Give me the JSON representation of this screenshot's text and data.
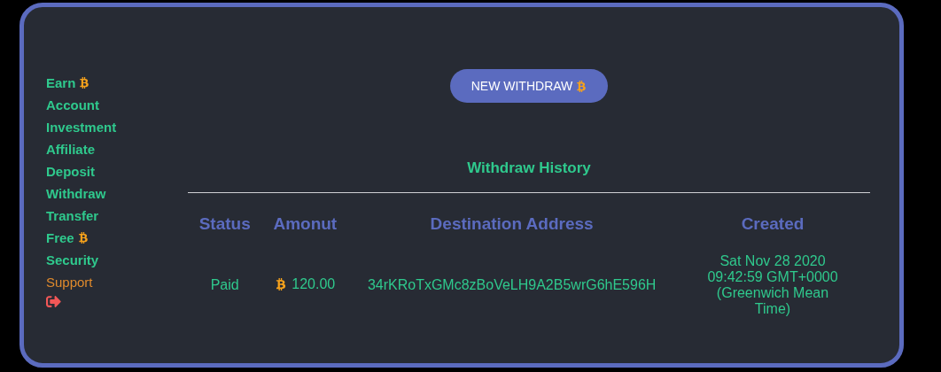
{
  "nav": [
    {
      "kind": "coin_link",
      "label": "Earn"
    },
    {
      "kind": "link",
      "label": "Account"
    },
    {
      "kind": "link",
      "label": "Investment"
    },
    {
      "kind": "link",
      "label": "Affiliate"
    },
    {
      "kind": "link",
      "label": "Deposit"
    },
    {
      "kind": "link",
      "label": "Withdraw"
    },
    {
      "kind": "link",
      "label": "Transfer"
    },
    {
      "kind": "coin_link",
      "label": "Free"
    },
    {
      "kind": "link",
      "label": "Security"
    },
    {
      "kind": "support",
      "label": "Support"
    },
    {
      "kind": "logout"
    }
  ],
  "new_withdraw_button": {
    "label": "NEW WITHDRAW"
  },
  "history": {
    "title": "Withdraw History",
    "columns": [
      "Status",
      "Amonut",
      "Destination Address",
      "Created"
    ],
    "rows": [
      {
        "status": "Paid",
        "amount": "120.00",
        "address": "34rKRoTxGMc8zBoVeLH9A2B5wrG6hE596H",
        "created": "Sat Nov 28 2020 09:42:59 GMT+0000 (Greenwich Mean Time)"
      }
    ]
  }
}
